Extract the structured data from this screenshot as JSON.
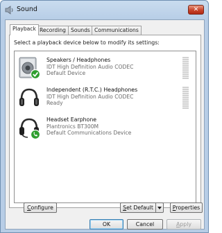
{
  "window": {
    "title": "Sound",
    "close_glyph": "✕"
  },
  "tabs": [
    {
      "label": "Playback",
      "active": true
    },
    {
      "label": "Recording",
      "active": false
    },
    {
      "label": "Sounds",
      "active": false
    },
    {
      "label": "Communications",
      "active": false
    }
  ],
  "instruction": "Select a playback device below to modify its settings:",
  "devices": [
    {
      "name": "Speakers / Headphones",
      "driver": "IDT High Definition Audio CODEC",
      "status": "Default Device",
      "icon": "speaker-icon",
      "badge": "green-check"
    },
    {
      "name": "Independent (R.T.C.) Headphones",
      "driver": "IDT High Definition Audio CODEC",
      "status": "Ready",
      "icon": "headphones-icon",
      "badge": "none"
    },
    {
      "name": "Headset Earphone",
      "driver": "Plantronics BT300M",
      "status": "Default Communications Device",
      "icon": "headset-icon",
      "badge": "green-phone"
    }
  ],
  "buttons": {
    "configure": {
      "mnemonic": "C",
      "rest": "onfigure"
    },
    "set_default": {
      "mnemonic": "S",
      "rest": "et Default"
    },
    "properties": {
      "mnemonic": "P",
      "rest": "roperties"
    },
    "ok": "OK",
    "cancel": "Cancel",
    "apply": {
      "mnemonic": "A",
      "rest": "pply"
    }
  },
  "colors": {
    "accent_blue": "#3c7fb1",
    "badge_green": "#2f9e2f",
    "close_red": "#c8432b"
  }
}
